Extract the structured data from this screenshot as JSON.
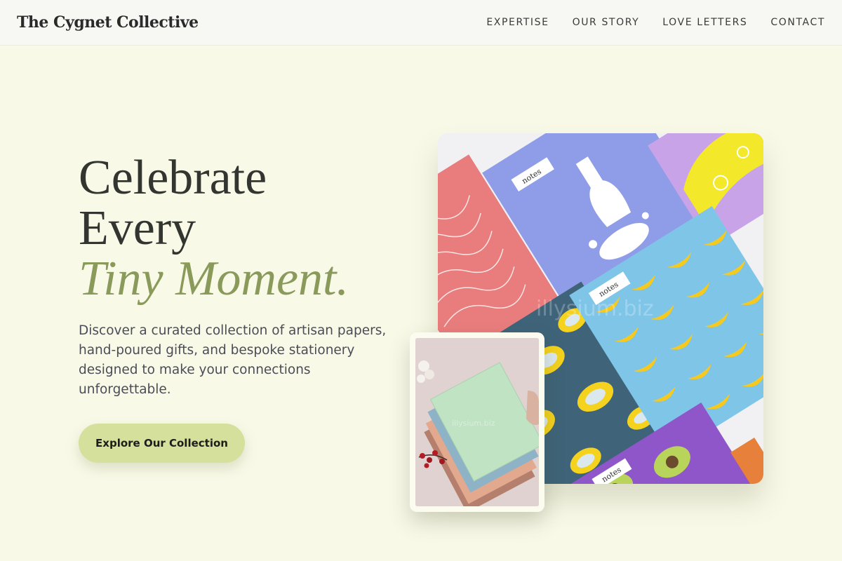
{
  "header": {
    "brand": "The Cygnet Collective",
    "nav": [
      "EXPERTISE",
      "OUR STORY",
      "LOVE LETTERS",
      "CONTACT"
    ]
  },
  "hero": {
    "headline_line1": "Celebrate",
    "headline_line2": "Every",
    "headline_accent": "Tiny Moment.",
    "description": "Discover a curated collection of artisan papers, hand-poured gifts, and bespoke stationery designed to make your connections unforgettable.",
    "cta_label": "Explore Our Collection"
  },
  "images": {
    "main_alt": "Patterned notebooks flat lay",
    "inset_alt": "Stack of pastel notebooks",
    "notebook_label": "notes",
    "watermark": "illysium.biz"
  },
  "colors": {
    "background": "#f9f9e8",
    "accent": "#8a9a5b",
    "cta": "#d4e09b"
  }
}
